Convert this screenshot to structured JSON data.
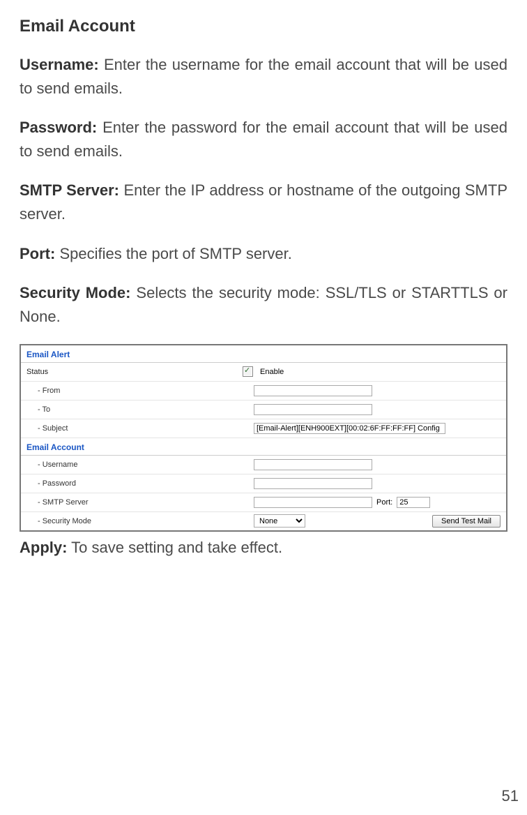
{
  "doc": {
    "heading": "Email Account",
    "paras": {
      "username_lead": "Username:",
      "username_text": " Enter the username for the email account that will be used to send emails.",
      "password_lead": "Password:",
      "password_text": " Enter the password for the email account that will be used to send emails.",
      "smtp_lead": "SMTP Server:",
      "smtp_text": " Enter the IP address or hostname of the outgoing SMTP server.",
      "port_lead": "Port:",
      "port_text": " Specifies the port of SMTP server.",
      "sec_lead": "Security Mode:",
      "sec_text": " Selects the security mode: SSL/TLS or STARTTLS or None.",
      "apply_lead": "Apply:",
      "apply_text": " To save setting and take effect."
    },
    "page_number": "51"
  },
  "panel": {
    "title1": "Email Alert",
    "status_label": "Status",
    "enable_label": "Enable",
    "from_label": "- From",
    "to_label": "- To",
    "subject_label": "- Subject",
    "subject_value": "[Email-Alert][ENH900EXT][00:02:6F:FF:FF:FF] Config",
    "title2": "Email Account",
    "username_label": "- Username",
    "password_label": "- Password",
    "smtp_label": "- SMTP Server",
    "port_label": "Port:",
    "port_value": "25",
    "secmode_label": "- Security Mode",
    "secmode_value": "None",
    "send_test_label": "Send Test Mail"
  }
}
